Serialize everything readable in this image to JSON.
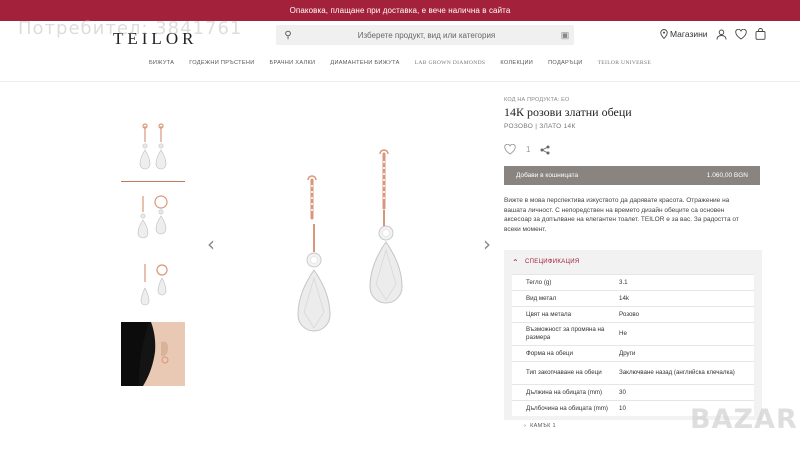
{
  "promo": {
    "text": "Опаковка, плащане при доставка, е вече налична в сайта"
  },
  "watermark": {
    "text": "Потребител: 3841761"
  },
  "header": {
    "logo": "TEILOR",
    "search_placeholder": "Изберете продукт, вид или категория",
    "stores_label": "Магазини",
    "icons": [
      "search-icon",
      "camera-icon",
      "location-pin-icon",
      "user-icon",
      "heart-icon",
      "bag-icon"
    ]
  },
  "nav": {
    "items": [
      {
        "label": "БИЖУТА"
      },
      {
        "label": "ГОДЕЖНИ ПРЪСТЕНИ"
      },
      {
        "label": "БРАЧНИ ХАЛКИ"
      },
      {
        "label": "ДИАМАНТЕНИ БИЖУТА"
      },
      {
        "label": "LAB GROWN DIAMONDS"
      },
      {
        "label": "КОЛЕКЦИИ"
      },
      {
        "label": "ПОДАРЪЦИ"
      },
      {
        "label": "TEILOR UNIVERSE"
      }
    ]
  },
  "product": {
    "code_label": "КОД НА ПРОДУКТА: ЕО",
    "title": "14К розови златни обеци",
    "subtitle": "РОЗОВО | ЗЛАТО 14К",
    "likes": "1",
    "cart_label": "Добави в кошницата",
    "price": "1.060,00 BGN",
    "description": "Вижте в мова перспектива изкуството да дарявате красота. Отражение на вашата личност. С непоредствен на времето дизайн обеците са основен аксесоар за допълване на елегантен тоалет. TEILOR е за вас. За радостта от всеки момент.",
    "specs_title": "СПЕЦИФИКАЦИЯ",
    "specs": [
      {
        "k": "Тегло (g)",
        "v": "3.1"
      },
      {
        "k": "Вид метал",
        "v": "14k"
      },
      {
        "k": "Цвят на метала",
        "v": "Розово"
      },
      {
        "k": "Възможност за промяна на размера",
        "v": "Не"
      },
      {
        "k": "Форма на обеци",
        "v": "Други"
      },
      {
        "k": "Тип закопчаване на обеци",
        "v": "Заключване назад (английска клечалка)"
      },
      {
        "k": "Дължина на обицата (mm)",
        "v": "30"
      },
      {
        "k": "Дълбочина на обицата (mm)",
        "v": "10"
      }
    ],
    "more_label": "КАМЪК 1"
  },
  "colors": {
    "promo": "#a3213a",
    "cart_button": "#8a8480",
    "accent": "#a3213a",
    "rose_gold": "#d9967a"
  },
  "bazar_logo": "BAZAR"
}
